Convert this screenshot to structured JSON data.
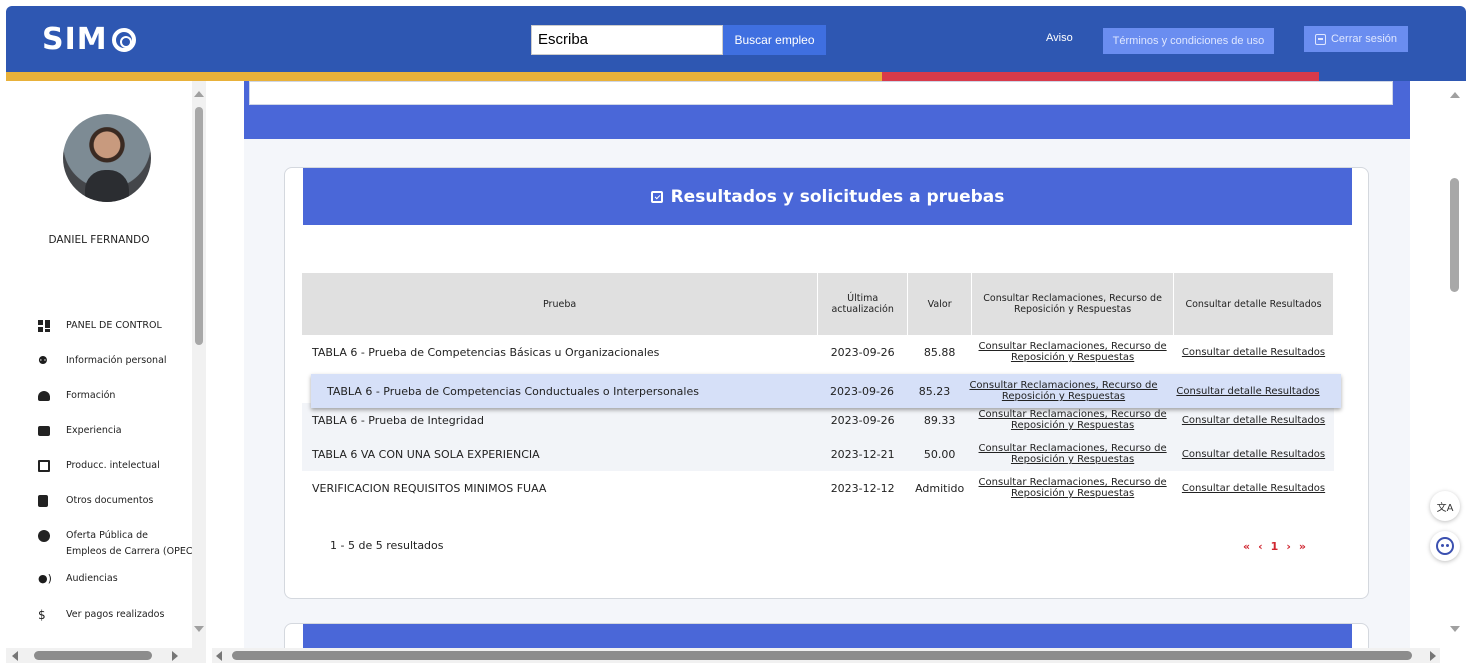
{
  "header": {
    "logo_text": "SIM",
    "search_value": "Escriba",
    "search_button": "Buscar empleo",
    "aviso": "Aviso",
    "terms_button": "Términos y condiciones de uso",
    "logout_button": "Cerrar sesión"
  },
  "colors": {
    "header_bg": "#2e57b2",
    "accent_blue": "#4a67d8",
    "stripe_yellow": "#e8b13a",
    "stripe_red": "#d83a4a",
    "highlight_row": "#d6e0f8",
    "pager_red": "#d02630"
  },
  "sidebar": {
    "user_name": "DANIEL FERNANDO",
    "items": [
      {
        "label": "PANEL DE CONTROL",
        "icon": "dashboard-icon"
      },
      {
        "label": "Información personal",
        "icon": "people-icon"
      },
      {
        "label": "Formación",
        "icon": "graduation-icon"
      },
      {
        "label": "Experiencia",
        "icon": "briefcase-icon"
      },
      {
        "label": "Producc. intelectual",
        "icon": "book-icon"
      },
      {
        "label": "Otros documentos",
        "icon": "document-icon"
      },
      {
        "label": "Oferta Pública de",
        "label2": "Empleos de Carrera (OPEC)",
        "icon": "offer-icon"
      },
      {
        "label": "Audiencias",
        "icon": "audience-icon"
      },
      {
        "label": "Ver pagos realizados",
        "icon": "dollar-icon"
      }
    ]
  },
  "main": {
    "card_title": "Resultados y solicitudes a pruebas",
    "table": {
      "headers": [
        "Prueba",
        "Última actualización",
        "Valor",
        "Consultar Reclamaciones, Recurso de Reposición y Respuestas",
        "Consultar detalle Resultados"
      ],
      "rows": [
        {
          "prueba": "TABLA 6 - Prueba de Competencias Básicas u Organizacionales",
          "fecha": "2023-09-26",
          "valor": "85.88",
          "link1": "Consultar Reclamaciones, Recurso de Reposición y Respuestas",
          "link2": "Consultar detalle Resultados"
        },
        {
          "prueba": "TABLA 6 - Prueba de Competencias Conductuales o Interpersonales",
          "fecha": "2023-09-26",
          "valor": "85.23",
          "link1": "Consultar Reclamaciones, Recurso de Reposición y Respuestas",
          "link2": "Consultar detalle Resultados"
        },
        {
          "prueba": "TABLA 6 - Prueba de Integridad",
          "fecha": "2023-09-26",
          "valor": "89.33",
          "link1": "Consultar Reclamaciones, Recurso de Reposición y Respuestas",
          "link2": "Consultar detalle Resultados"
        },
        {
          "prueba": "TABLA 6 VA CON UNA SOLA EXPERIENCIA",
          "fecha": "2023-12-21",
          "valor": "50.00",
          "link1": "Consultar Reclamaciones, Recurso de Reposición y Respuestas",
          "link2": "Consultar detalle Resultados"
        },
        {
          "prueba": "VERIFICACION REQUISITOS MINIMOS FUAA",
          "fecha": "2023-12-12",
          "valor": "Admitido",
          "link1": "Consultar Reclamaciones, Recurso de Reposición y Respuestas",
          "link2": "Consultar detalle Resultados"
        }
      ]
    },
    "results_count": "1 - 5 de 5 resultados",
    "pager": {
      "first": "«",
      "prev": "‹",
      "page": "1",
      "next": "›",
      "last": "»"
    }
  }
}
